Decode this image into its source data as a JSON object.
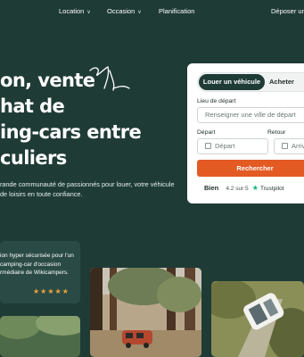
{
  "nav": {
    "location": "Location",
    "occasion": "Occasion",
    "planification": "Planification",
    "deposer": "Déposer une"
  },
  "hero": {
    "line1": "on, vente",
    "line2": "hat de",
    "line3": "ing-cars entre",
    "line4": "culiers",
    "subtext": "rande communauté de passionnés pour louer, votre véhicule de loisirs en toute confiance."
  },
  "search_card": {
    "tab_rent": "Louer un véhicule",
    "tab_buy": "Acheter",
    "lieu_label": "Lieu de départ",
    "lieu_placeholder": "Renseigner une ville de départ",
    "depart_label": "Départ",
    "depart_placeholder": "Départ",
    "retour_label": "Retour",
    "retour_placeholder": "Arrivé",
    "search_button": "Rechercher",
    "rating_word": "Bien",
    "rating_score": "4.2 sur 5",
    "rating_source": "Trustpilot"
  },
  "info_card": {
    "text": "ion hyper sécurisée pour l'un camping-car d'occasion rmédiaire de Wikicampers.",
    "stars": "★★★★★"
  },
  "colors": {
    "background": "#1f3b36",
    "accent": "#e35a23",
    "tab_active": "#1f3b36",
    "star": "#f2a23a",
    "trustpilot": "#00b67a"
  }
}
